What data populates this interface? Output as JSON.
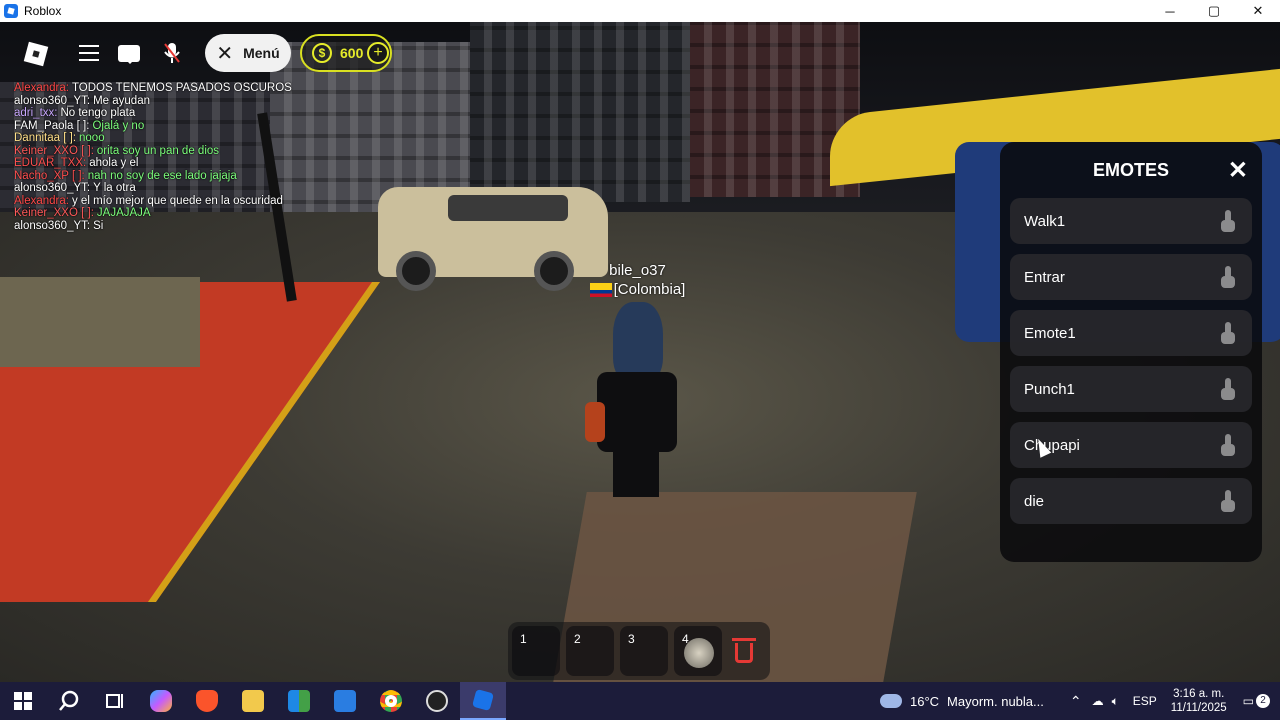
{
  "window": {
    "title": "Roblox",
    "controls": [
      "─",
      "▢",
      "✕"
    ]
  },
  "hud": {
    "menu_label": "Menú",
    "coins": "600",
    "coin_symbol": "$",
    "plus_symbol": "+"
  },
  "player": {
    "name": "bile_o37",
    "country": "[Colombia]"
  },
  "chat": [
    {
      "user": "Alexandra:",
      "msg": "TODOS TENEMOS PASADOS OSCUROS",
      "ucolor": "#ff4a4a",
      "mcolor": "#ffffff"
    },
    {
      "user": "alonso360_YT:",
      "msg": "Me ayudan",
      "ucolor": "#ffffff",
      "mcolor": "#ffffff"
    },
    {
      "user": "adri_txx:",
      "msg": "No tengo plata",
      "ucolor": "#c9a8ff",
      "mcolor": "#ffffff"
    },
    {
      "user": "FAM_Paola [  ]:",
      "msg": "Ojalá y no",
      "ucolor": "#ffffff",
      "mcolor": "#7dff7d"
    },
    {
      "user": "Dannitaa [  ]:",
      "msg": "nooo",
      "ucolor": "#ffe08a",
      "mcolor": "#7dff7d"
    },
    {
      "user": "Keiner_XXO [  ]:",
      "msg": "orita soy un pan de dios",
      "ucolor": "#ff5a5a",
      "mcolor": "#7dff7d"
    },
    {
      "user": "EDUAR_TXX:",
      "msg": "ahola y el",
      "ucolor": "#ff5050",
      "mcolor": "#ffffff"
    },
    {
      "user": "Nacho_XP [  ]:",
      "msg": "nah no soy de ese lado jajaja",
      "ucolor": "#ff5050",
      "mcolor": "#7dff7d"
    },
    {
      "user": "alonso360_YT:",
      "msg": "Y la otra",
      "ucolor": "#ffffff",
      "mcolor": "#ffffff"
    },
    {
      "user": "Alexandra:",
      "msg": "y el mío mejor que quede en la oscuridad",
      "ucolor": "#ff4a4a",
      "mcolor": "#ffffff"
    },
    {
      "user": "Keiner_XXO [  ]:",
      "msg": "JAJAJAJA",
      "ucolor": "#ff5a5a",
      "mcolor": "#7dff7d"
    },
    {
      "user": "alonso360_YT:",
      "msg": "Si",
      "ucolor": "#ffffff",
      "mcolor": "#ffffff"
    }
  ],
  "emotes_panel": {
    "title": "EMOTES",
    "close": "✕",
    "items": [
      "Walk1",
      "Entrar",
      "Emote1",
      "Punch1",
      "Chupapi",
      "die"
    ]
  },
  "hotbar": {
    "slots": [
      "1",
      "2",
      "3",
      "4"
    ]
  },
  "taskbar": {
    "weather_temp": "16°C",
    "weather_text": "Mayorm. nubla...",
    "language": "ESP",
    "time": "3:16 a. m.",
    "date": "11/11/2025",
    "notifications": "2",
    "app_colors": {
      "start": "#ffffff",
      "copilot": "#c45bff",
      "brave": "#fb542b",
      "explorer": "#f2c94c",
      "store": "#1e88e5",
      "outlook": "#2a7de1",
      "chrome": "#34a853",
      "obs": "#222222",
      "roblox": "#1a73e8"
    }
  }
}
